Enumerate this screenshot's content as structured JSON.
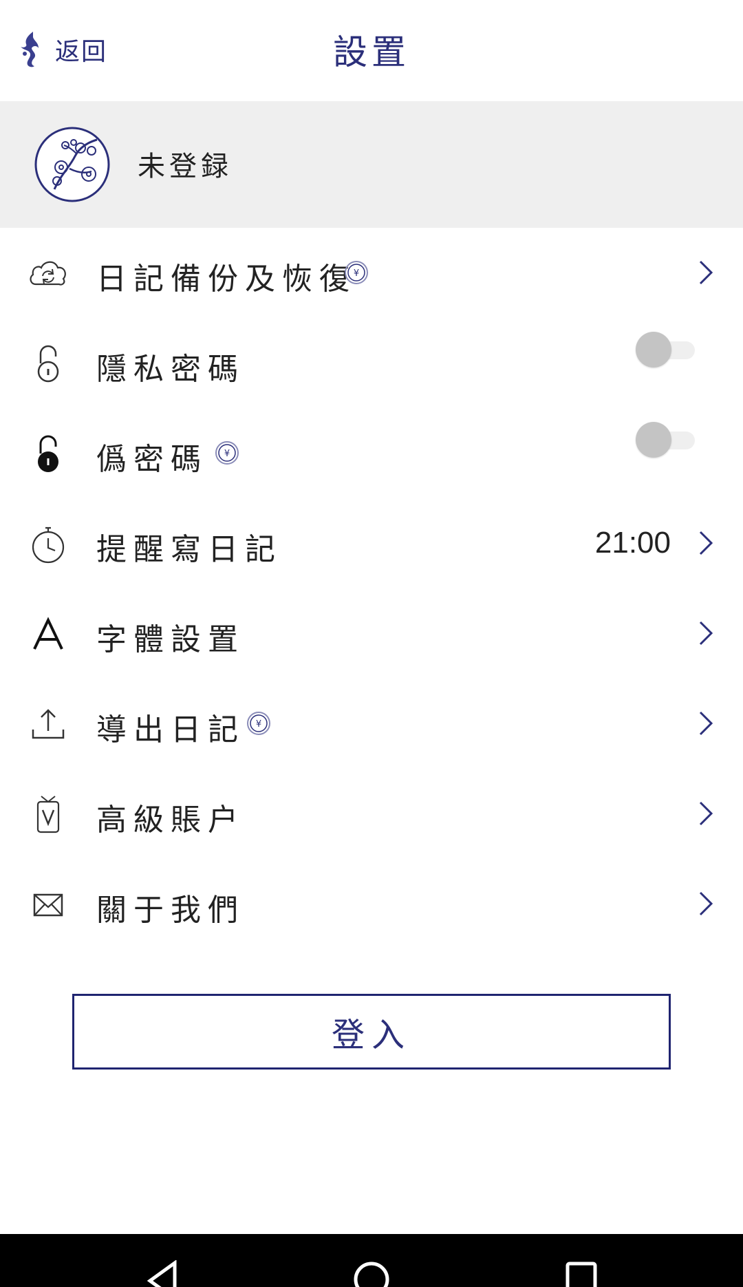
{
  "header": {
    "back_label": "返回",
    "title": "設置"
  },
  "account": {
    "status": "未登録"
  },
  "settings": {
    "items": [
      {
        "label": "日記備份及恢復",
        "icon": "cloud-sync-icon",
        "premium": true,
        "control": "chevron"
      },
      {
        "label": "隱私密碼",
        "icon": "unlock-icon",
        "premium": false,
        "control": "toggle",
        "enabled": false
      },
      {
        "label": "僞密碼",
        "icon": "lock-filled-icon",
        "premium": true,
        "control": "toggle",
        "enabled": false
      },
      {
        "label": "提醒寫日記",
        "icon": "stopwatch-icon",
        "premium": false,
        "control": "chevron",
        "value": "21:00"
      },
      {
        "label": "字體設置",
        "icon": "font-icon",
        "premium": false,
        "control": "chevron"
      },
      {
        "label": "導出日記",
        "icon": "upload-icon",
        "premium": true,
        "control": "chevron"
      },
      {
        "label": "高級賬户",
        "icon": "vip-tag-icon",
        "premium": false,
        "control": "chevron"
      },
      {
        "label": "關于我們",
        "icon": "mail-icon",
        "premium": false,
        "control": "chevron"
      }
    ]
  },
  "login_button": {
    "label": "登入"
  },
  "colors": {
    "accent": "#2b2f7a",
    "button_border": "#1f2470",
    "account_bg": "#efefef",
    "toggle_knob": "#c4c4c4",
    "navbar": "#000000"
  }
}
